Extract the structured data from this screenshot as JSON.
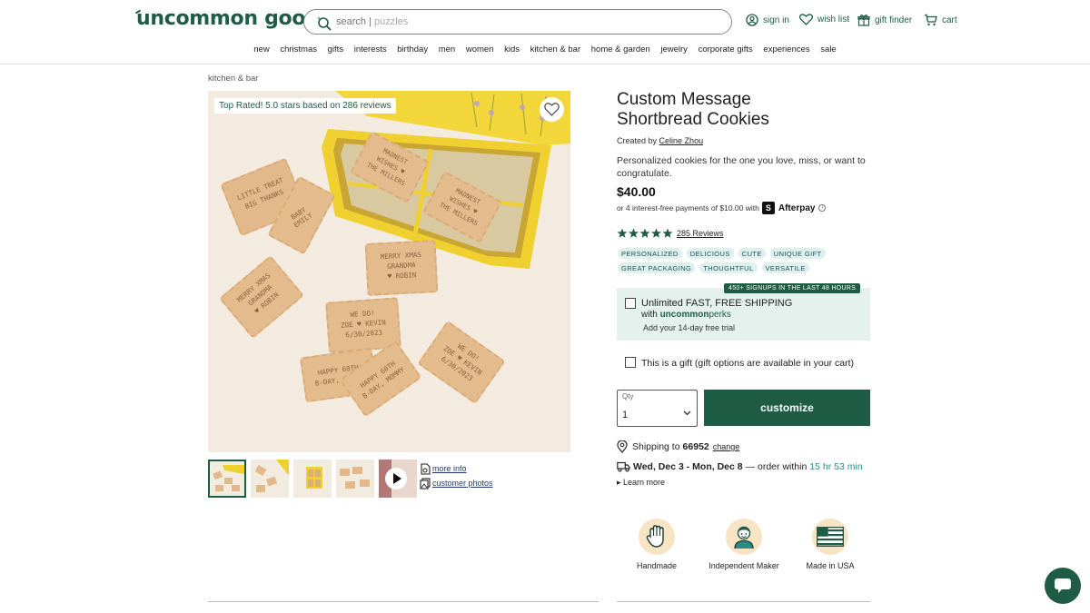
{
  "header": {
    "logo": "uncommon goods",
    "search": {
      "prefix": "search |",
      "placeholder": "puzzles"
    },
    "utility": {
      "sign_in": "sign in",
      "wish_list": "wish list",
      "gift_finder": "gift finder",
      "cart": "cart"
    },
    "nav": [
      "new",
      "christmas",
      "gifts",
      "interests",
      "birthday",
      "men",
      "women",
      "kids",
      "kitchen & bar",
      "home & garden",
      "jewelry",
      "corporate gifts",
      "experiences",
      "sale"
    ]
  },
  "breadcrumb": "kitchen & bar",
  "gallery": {
    "rating_badge": "Top Rated! 5.0 stars based on 286 reviews",
    "cookies": [
      [
        "LITTLE TREAT",
        "BIG THANKS"
      ],
      [
        "BABY EMILY"
      ],
      [
        "MERRY XMAS",
        "GRANDMA",
        "♥ ROBIN"
      ],
      [
        "MERRY XMAS",
        "GRANDMA",
        "♥ ROBIN"
      ],
      [
        "WE DO!",
        "ZOE ♥ KEVIN",
        "6/30/2023"
      ],
      [
        "WE DO!",
        "ZOE ♥ KEVIN",
        "6/30/2023"
      ],
      [
        "HAPPY 60TH",
        "B-DAY, MOMMY"
      ],
      [
        "HAPPY 60TH",
        "B-DAY, MOMMY"
      ],
      [
        "MADNEST",
        "WISHES ♥",
        "THE MILLERS"
      ],
      [
        "MADNEST",
        "WISHES ♥",
        "THE MILLERS"
      ]
    ],
    "links": {
      "more_info": "more info",
      "customer_photos": "customer photos"
    }
  },
  "product": {
    "title_line1": "Custom Message",
    "title_line2": "Shortbread Cookies",
    "created_by_label": "Created by",
    "creator": "Celine Zhou",
    "description": "Personalized cookies for the one you love, miss, or want to congratulate.",
    "price": "$40.00",
    "afterpay_text": "or 4 interest-free payments of $10.00 with",
    "afterpay_brand": "Afterpay",
    "rating": 5,
    "reviews_label": "285 Reviews",
    "tags": [
      "PERSONALIZED",
      "DELICIOUS",
      "CUTE",
      "UNIQUE GIFT",
      "GREAT PACKAGING",
      "THOUGHTFUL",
      "VERSATILE"
    ]
  },
  "perks": {
    "badge": "450+ SIGNUPS IN THE LAST 48 HOURS",
    "main": "Unlimited FAST, FREE SHIPPING",
    "with": "with",
    "brand_bold": "uncommon",
    "brand_light": "perks",
    "trial": "Add your 14-day free trial"
  },
  "gift_option": "This is a gift (gift options are available in your cart)",
  "purchase": {
    "qty_label": "Qty",
    "qty_value": "1",
    "customize_label": "customize"
  },
  "shipping": {
    "label": "Shipping to",
    "zip": "66952",
    "change": "change",
    "delivery_dates": "Wed, Dec 3 - Mon, Dec 8",
    "order_within": "— order within",
    "countdown": "15 hr 53 min",
    "learn_more": "▸ Learn more"
  },
  "features": [
    {
      "label": "Handmade",
      "icon": "hand-icon"
    },
    {
      "label": "Independent Maker",
      "icon": "maker-icon"
    },
    {
      "label": "Made in USA",
      "icon": "usa-flag-icon"
    }
  ],
  "colors": {
    "brand_green": "#1f5c45",
    "perks_bg": "#e4f1ec",
    "tag_bg": "#dff0f1",
    "countdown_teal": "#2a8b85",
    "feature_circle": "#f6e4c5"
  }
}
